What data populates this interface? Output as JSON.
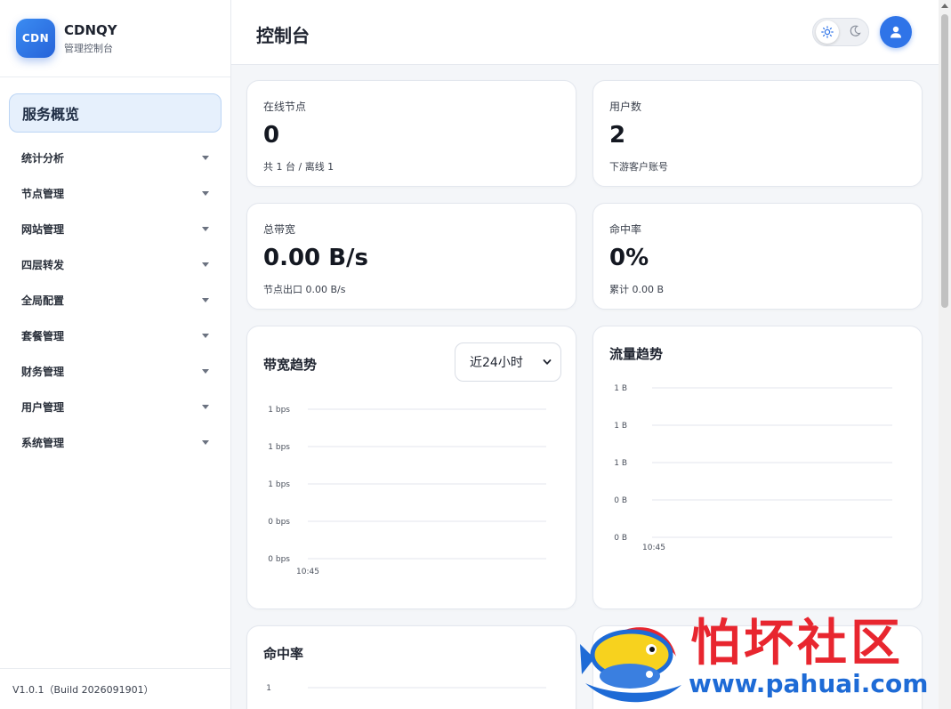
{
  "brand": {
    "logo_text": "CDN",
    "name": "CDNQY",
    "subtitle": "管理控制台"
  },
  "sidebar": {
    "active": "服务概览",
    "items": [
      {
        "label": "统计分析"
      },
      {
        "label": "节点管理"
      },
      {
        "label": "网站管理"
      },
      {
        "label": "四层转发"
      },
      {
        "label": "全局配置"
      },
      {
        "label": "套餐管理"
      },
      {
        "label": "财务管理"
      },
      {
        "label": "用户管理"
      },
      {
        "label": "系统管理"
      }
    ],
    "footer": "V1.0.1（Build 2026091901）"
  },
  "header": {
    "title": "控制台",
    "theme_toggle": {
      "icons": [
        "sun-icon",
        "moon-icon"
      ]
    },
    "avatar_icon": "user-icon"
  },
  "stats": [
    {
      "label": "在线节点",
      "value": "0",
      "sub": "共 1 台 / 离线 1"
    },
    {
      "label": "用户数",
      "value": "2",
      "sub": "下游客户账号"
    },
    {
      "label": "总带宽",
      "value": "0.00 B/s",
      "sub": "节点出口 0.00 B/s"
    },
    {
      "label": "命中率",
      "value": "0%",
      "sub": "累计 0.00 B"
    }
  ],
  "charts": {
    "bandwidth": {
      "title": "带宽趋势",
      "range": "近24小时"
    },
    "traffic": {
      "title": "流量趋势"
    },
    "hit_rate": {
      "title": "命中率"
    }
  },
  "chart_data": [
    {
      "type": "line",
      "title": "带宽趋势",
      "x": [
        "10:45"
      ],
      "y_ticks": [
        "1 bps",
        "1 bps",
        "1 bps",
        "0 bps",
        "0 bps"
      ],
      "series": [],
      "grid": true
    },
    {
      "type": "line",
      "title": "流量趋势",
      "x": [
        "10:45"
      ],
      "y_ticks": [
        "1 B",
        "1 B",
        "1 B",
        "0 B",
        "0 B"
      ],
      "series": [],
      "grid": true
    },
    {
      "type": "line",
      "title": "命中率",
      "x": [],
      "y_ticks": [
        "1"
      ],
      "series": [],
      "grid": true
    }
  ],
  "watermark": {
    "text": "怕坏社区",
    "url": "www.pahuai.com"
  },
  "colors": {
    "accent": "#2f74e8",
    "active_bg": "#e6f0fc",
    "watermark_red": "#e8262f",
    "watermark_blue": "#1e6bd6"
  }
}
